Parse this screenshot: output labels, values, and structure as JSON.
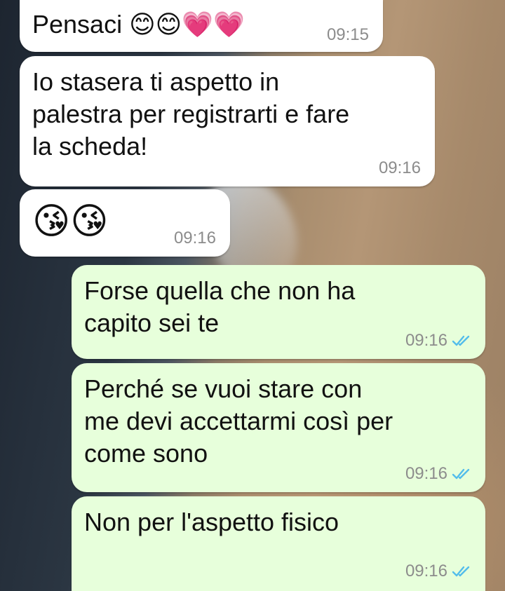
{
  "messages": [
    {
      "direction": "in",
      "text": "Pensaci 😊😊💗💗",
      "time": "09:15"
    },
    {
      "direction": "in",
      "text": "Io stasera ti aspetto in\npalestra per registrarti e fare\nla scheda!",
      "time": "09:16"
    },
    {
      "direction": "in",
      "text": "😘😘",
      "time": "09:16"
    },
    {
      "direction": "out",
      "text": "Forse quella che non ha\ncapito sei te",
      "time": "09:16",
      "status": "read"
    },
    {
      "direction": "out",
      "text": "Perché se vuoi stare con\nme devi accettarmi così per\ncome sono",
      "time": "09:16",
      "status": "read"
    },
    {
      "direction": "out",
      "text": "Non per l'aspetto fisico",
      "time": "09:16",
      "status": "read"
    }
  ],
  "icons": {
    "read_receipt": "double-check-icon"
  },
  "colors": {
    "incoming_bubble": "#ffffff",
    "outgoing_bubble": "#e7ffdb",
    "read_ticks": "#53bdeb",
    "timestamp": "#8c8c8c"
  }
}
